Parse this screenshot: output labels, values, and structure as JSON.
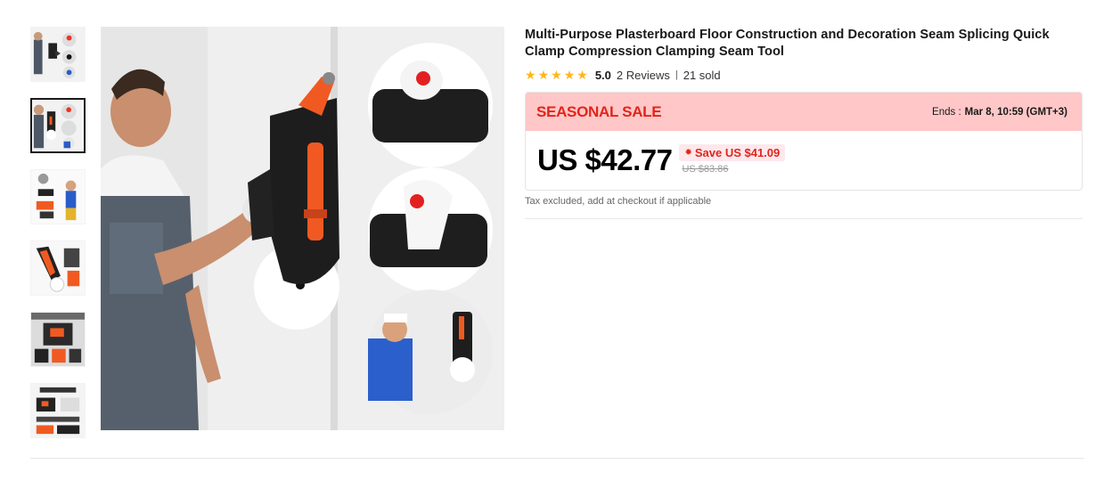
{
  "product": {
    "title": "Multi-Purpose Plasterboard Floor Construction and Decoration Seam Splicing Quick Clamp Compression Clamping Seam Tool",
    "rating": "5.0",
    "reviews": "2 Reviews",
    "separator": "|",
    "sold": "21 sold",
    "star_count": 5
  },
  "sale": {
    "title": "SEASONAL SALE",
    "ends_label": "Ends :",
    "ends_value": "Mar 8, 10:59 (GMT+3)",
    "price": "US $42.77",
    "save_icon": "✹",
    "save_text": "Save US $41.09",
    "original_price": "US $83.86",
    "tax_note": "Tax excluded, add at checkout if applicable"
  },
  "gallery": {
    "thumbnails": [
      "thumb-1",
      "thumb-2",
      "thumb-3",
      "thumb-4",
      "thumb-5",
      "thumb-6"
    ],
    "active_index": 1
  },
  "colors": {
    "accent_red": "#e1251b",
    "sale_bg": "#ffc7c7",
    "star": "#fdb71c",
    "tool_orange": "#f05a22"
  }
}
